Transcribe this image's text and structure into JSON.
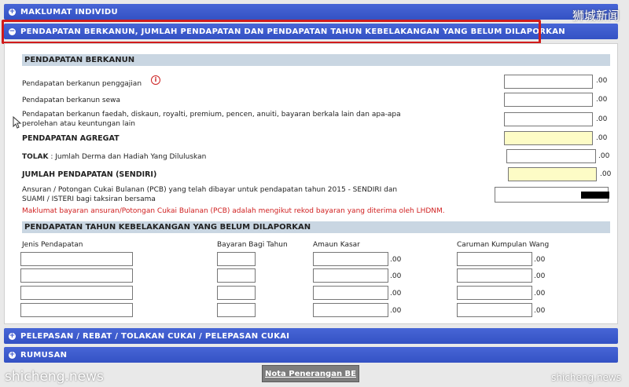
{
  "accordion": {
    "maklumat_individu": "MAKLUMAT INDIVIDU",
    "pendapatan_section": "PENDAPATAN BERKANUN, JUMLAH PENDAPATAN DAN PENDAPATAN TAHUN KEBELAKANGAN YANG BELUM DILAPORKAN",
    "pelepasan": "PELEPASAN / REBAT / TOLAKAN CUKAI / PELEPASAN CUKAI",
    "rumusan": "RUMUSAN"
  },
  "icons": {
    "expand": "plus-circle-icon",
    "collapse": "minus-circle-icon",
    "info": "info-icon"
  },
  "watermark": {
    "top_right": "狮城新闻",
    "bottom_left": "shicheng.news",
    "bottom_right": "shicheng.news"
  },
  "statutory": {
    "heading": "PENDAPATAN BERKANUN",
    "employment": "Pendapatan berkanun penggajian",
    "rent": "Pendapatan berkanun sewa",
    "interest_line1": "Pendapatan berkanun faedah, diskaun, royalti, premium, pencen, anuiti, bayaran berkala lain dan apa-apa",
    "interest_line2": "perolehan atau keuntungan lain",
    "aggregate": "PENDAPATAN AGREGAT",
    "tolak_label": "TOLAK",
    "tolak_text": ": Jumlah Derma dan Hadiah Yang Diluluskan",
    "total_self": "JUMLAH PENDAPATAN (SENDIRI)",
    "pcb_line1": "Ansuran / Potongan Cukai Bulanan (PCB) yang telah dibayar untuk pendapatan tahun 2015 - SENDIRI dan",
    "pcb_line2": "SUAMI / ISTERI bagi taksiran bersama",
    "pcb_note": "Maklumat bayaran ansuran/Potongan Cukai Bulanan (PCB) adalah mengikut rekod bayaran yang diterima oleh LHDNM.",
    "decimal": ".00"
  },
  "prior_year": {
    "heading": "PENDAPATAN TAHUN KEBELAKANGAN YANG BELUM DILAPORKAN",
    "col_jenis": "Jenis Pendapatan",
    "col_bayaran": "Bayaran Bagi Tahun",
    "col_amaun": "Amaun Kasar",
    "col_caruman": "Caruman Kumpulan Wang",
    "decimal": ".00"
  },
  "footer": {
    "nota_button": "Nota Penerangan BE"
  }
}
